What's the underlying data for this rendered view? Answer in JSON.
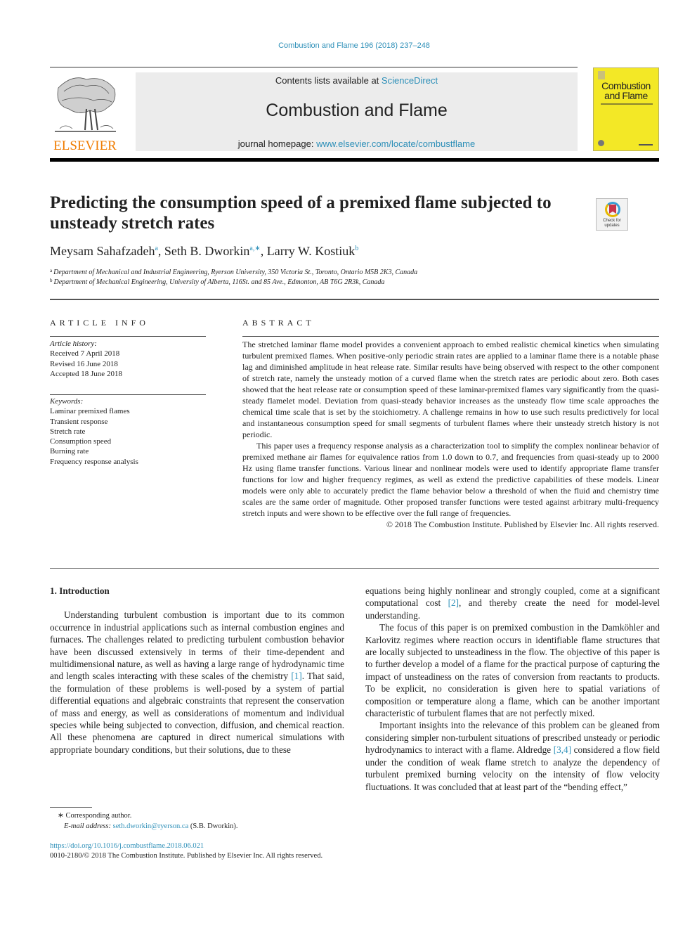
{
  "journal_ref": "Combustion and Flame 196 (2018) 237–248",
  "header": {
    "publisher_logo_text": "ELSEVIER",
    "contents_prefix": "Contents lists available at ",
    "contents_link": "ScienceDirect",
    "journal_title": "Combustion and Flame",
    "homepage_prefix": "journal homepage: ",
    "homepage_link": "www.elsevier.com/locate/combustflame",
    "cover_title_line1": "Combustion",
    "cover_title_line2": "and Flame"
  },
  "article": {
    "title": "Predicting the consumption speed of a premixed flame subjected to unsteady stretch rates",
    "crossmark_line1": "Check for",
    "crossmark_line2": "updates",
    "authors": [
      {
        "name": "Meysam Sahafzadeh",
        "sup": "a"
      },
      {
        "name": "Seth B. Dworkin",
        "sup": "a,∗"
      },
      {
        "name": "Larry W. Kostiuk",
        "sup": "b"
      }
    ],
    "affiliations": [
      {
        "sup": "a",
        "text": "Department of Mechanical and Industrial Engineering, Ryerson University, 350 Victoria St., Toronto, Ontario M5B 2K3, Canada"
      },
      {
        "sup": "b",
        "text": "Department of Mechanical Engineering, University of Alberta, 116St. and 85 Ave., Edmonton, AB T6G 2R3k, Canada"
      }
    ]
  },
  "article_info": {
    "heading": "ARTICLE INFO",
    "history_label": "Article history:",
    "received": "Received 7 April 2018",
    "revised": "Revised 16 June 2018",
    "accepted": "Accepted 18 June 2018",
    "keywords_label": "Keywords:",
    "keywords": [
      "Laminar premixed flames",
      "Transient response",
      "Stretch rate",
      "Consumption speed",
      "Burning rate",
      "Frequency response analysis"
    ]
  },
  "abstract": {
    "heading": "ABSTRACT",
    "p1": "The stretched laminar flame model provides a convenient approach to embed realistic chemical kinetics when simulating turbulent premixed flames. When positive-only periodic strain rates are applied to a laminar flame there is a notable phase lag and diminished amplitude in heat release rate. Similar results have being observed with respect to the other component of stretch rate, namely the unsteady motion of a curved flame when the stretch rates are periodic about zero. Both cases showed that the heat release rate or consumption speed of these laminar-premixed flames vary significantly from the quasi-steady flamelet model. Deviation from quasi-steady behavior increases as the unsteady flow time scale approaches the chemical time scale that is set by the stoichiometry. A challenge remains in how to use such results predictively for local and instantaneous consumption speed for small segments of turbulent flames where their unsteady stretch history is not periodic.",
    "p2": "This paper uses a frequency response analysis as a characterization tool to simplify the complex nonlinear behavior of premixed methane air flames for equivalence ratios from 1.0 down to 0.7, and frequencies from quasi-steady up to 2000 Hz using flame transfer functions. Various linear and nonlinear models were used to identify appropriate flame transfer functions for low and higher frequency regimes, as well as extend the predictive capabilities of these models. Linear models were only able to accurately predict the flame behavior below a threshold of when the fluid and chemistry time scales are the same order of magnitude. Other proposed transfer functions were tested against arbitrary multi-frequency stretch inputs and were shown to be effective over the full range of frequencies.",
    "copyright": "© 2018 The Combustion Institute. Published by Elsevier Inc. All rights reserved."
  },
  "body": {
    "section_heading": "1. Introduction",
    "left_p1_a": "Understanding turbulent combustion is important due to its common occurrence in industrial applications such as internal combustion engines and furnaces. The challenges related to predicting turbulent combustion behavior have been discussed extensively in terms of their time-dependent and multidimensional nature, as well as having a large range of hydrodynamic time and length scales interacting with these scales of the chemistry ",
    "ref1": "[1]",
    "left_p1_b": ". That said, the formulation of these problems is well-posed by a system of partial differential equations and algebraic constraints that represent the conservation of mass and energy, as well as considerations of momentum and individual species while being subjected to convection, diffusion, and chemical reaction. All these phenomena are captured in direct numerical simulations with appropriate boundary conditions, but their solutions, due to these",
    "right_p1_a": "equations being highly nonlinear and strongly coupled, come at a significant computational cost ",
    "ref2": "[2]",
    "right_p1_b": ", and thereby create the need for model-level understanding.",
    "right_p2": "The focus of this paper is on premixed combustion in the Damköhler and Karlovitz regimes where reaction occurs in identifiable flame structures that are locally subjected to unsteadiness in the flow. The objective of this paper is to further develop a model of a flame for the practical purpose of capturing the impact of unsteadiness on the rates of conversion from reactants to products. To be explicit, no consideration is given here to spatial variations of composition or temperature along a flame, which can be another important characteristic of turbulent flames that are not perfectly mixed.",
    "right_p3_a": "Important insights into the relevance of this problem can be gleaned from considering simpler non-turbulent situations of prescribed unsteady or periodic hydrodynamics to interact with a flame. Aldredge ",
    "ref34": "[3,4]",
    "right_p3_b": " considered a flow field under the condition of weak flame stretch to analyze the dependency of turbulent premixed burning velocity on the intensity of flow velocity fluctuations. It was concluded that at least part of the “bending effect,”"
  },
  "footer": {
    "corresponding_mark": "∗",
    "corresponding_text": "Corresponding author.",
    "email_label": "E-mail address:",
    "email": "seth.dworkin@ryerson.ca",
    "email_suffix": " (S.B. Dworkin).",
    "doi": "https://doi.org/10.1016/j.combustflame.2018.06.021",
    "issn": "0010-2180/© 2018 The Combustion Institute. Published by Elsevier Inc. All rights reserved."
  }
}
